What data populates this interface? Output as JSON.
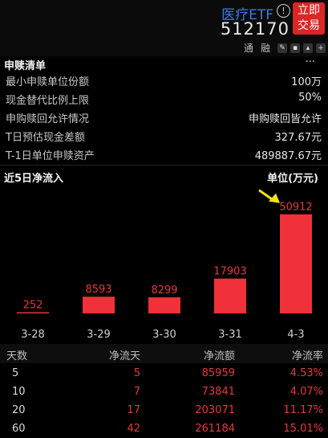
{
  "header": {
    "etf_name": "医疗ETF",
    "info_icon": "info-circle-icon",
    "etf_code": "512170",
    "trade_button": "立即\n交易",
    "trade_line1": "立即",
    "trade_line2": "交易",
    "tools": [
      "通",
      "融"
    ],
    "tool_icons": [
      "edit-icon",
      "lock-icon",
      "bell-icon",
      "plus-icon"
    ]
  },
  "subscription": {
    "title": "申赎清单",
    "more": "···",
    "rows": [
      {
        "label": "最小申赎单位份额",
        "value": "100万"
      },
      {
        "label": "现金替代比例上限",
        "value": "50%"
      },
      {
        "label": "申购赎回允许情况",
        "value": "申购赎回皆允许"
      },
      {
        "label": "T日预估现金差额",
        "value": "327.67元"
      },
      {
        "label": "T-1日单位申赎资产",
        "value": "489887.67元"
      }
    ]
  },
  "inflow": {
    "title": "近5日净流入",
    "unit": "单位(万元)"
  },
  "chart_data": {
    "type": "bar",
    "title": "近5日净流入",
    "ylabel": "单位(万元)",
    "categories": [
      "3-28",
      "3-29",
      "3-30",
      "3-31",
      "4-3"
    ],
    "values": [
      252,
      8593,
      8299,
      17903,
      50912
    ],
    "value_labels": [
      "252",
      "8593",
      "8299",
      "17903",
      "50912"
    ],
    "ylim": [
      0,
      52000
    ],
    "bar_color": "#f0313a",
    "label_color": "#e53a3a",
    "annotation_arrow_color": "#f2e313"
  },
  "table": {
    "headers": [
      "天数",
      "净流天",
      "净流额",
      "净流率"
    ],
    "rows": [
      [
        "5",
        "5",
        "85959",
        "4.53%"
      ],
      [
        "10",
        "7",
        "73841",
        "4.07%"
      ],
      [
        "20",
        "17",
        "203071",
        "11.17%"
      ],
      [
        "60",
        "42",
        "261184",
        "15.01%"
      ]
    ]
  }
}
